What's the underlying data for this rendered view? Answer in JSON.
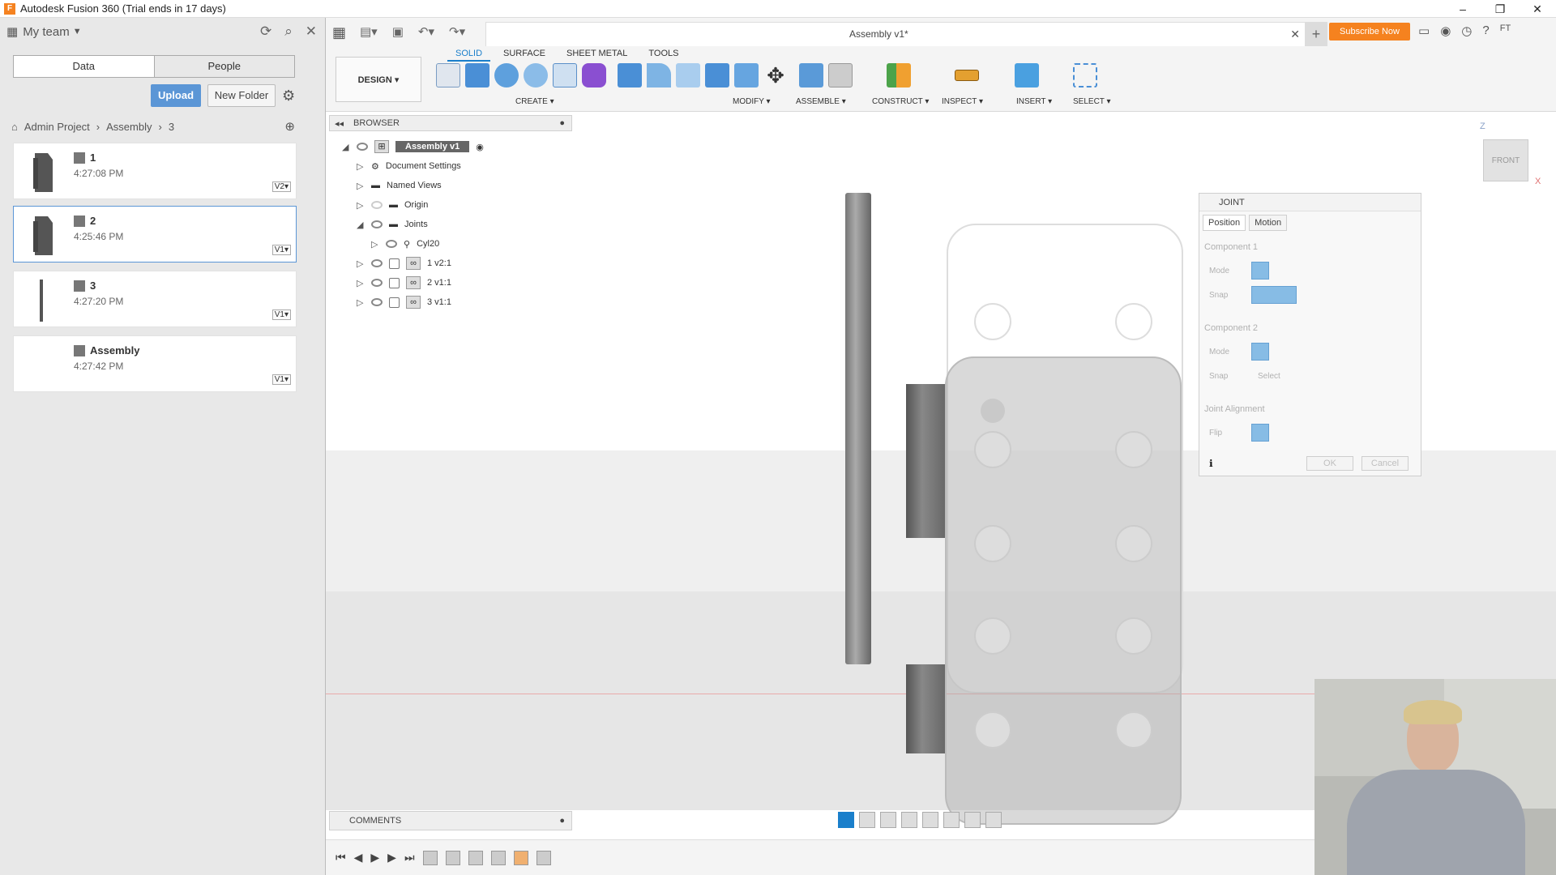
{
  "app": {
    "title": "Autodesk Fusion 360 (Trial ends in 17 days)",
    "logo_letter": "F",
    "icon": "fusion-logo-icon"
  },
  "window_controls": {
    "minimize": "–",
    "maximize": "❐",
    "close": "✕"
  },
  "data_panel": {
    "team_label": "My team",
    "tabs": [
      "Data",
      "People"
    ],
    "active_tab": "Data",
    "upload_label": "Upload",
    "new_folder_label": "New Folder",
    "breadcrumb": [
      "Admin Project",
      "Assembly",
      "3"
    ],
    "files": [
      {
        "name": "1",
        "time": "4:27:08 PM",
        "version": "V2▾"
      },
      {
        "name": "2",
        "time": "4:25:46 PM",
        "version": "V1▾",
        "selected": true
      },
      {
        "name": "3",
        "time": "4:27:20 PM",
        "version": "V1▾"
      },
      {
        "name": "Assembly",
        "time": "4:27:42 PM",
        "version": "V1▾"
      }
    ]
  },
  "document": {
    "tab_title": "Assembly v1*",
    "subscribe_label": "Subscribe Now",
    "user_initials": "FT"
  },
  "ribbon": {
    "tabs": [
      "SOLID",
      "SURFACE",
      "SHEET METAL",
      "TOOLS"
    ],
    "active_tab": "SOLID",
    "workspace_label": "DESIGN ▾",
    "groups": [
      "CREATE ▾",
      "MODIFY ▾",
      "ASSEMBLE ▾",
      "CONSTRUCT ▾",
      "INSPECT ▾",
      "INSERT ▾",
      "SELECT ▾"
    ]
  },
  "browser": {
    "title": "BROWSER",
    "root": "Assembly v1",
    "items": [
      {
        "label": "Document Settings",
        "icon": "gear-icon"
      },
      {
        "label": "Named Views",
        "icon": "folder-icon"
      },
      {
        "label": "Origin",
        "icon": "folder-icon"
      },
      {
        "label": "Joints",
        "icon": "folder-icon",
        "expanded": true
      },
      {
        "label": "Cyl20",
        "icon": "joint-icon",
        "child": true
      },
      {
        "label": "1 v2:1",
        "icon": "link-icon"
      },
      {
        "label": "2 v1:1",
        "icon": "link-icon"
      },
      {
        "label": "3 v1:1",
        "icon": "link-icon"
      }
    ]
  },
  "joint_panel": {
    "title": "JOINT",
    "tabs": [
      "Position",
      "Motion"
    ],
    "component1": "Component 1",
    "component2": "Component 2",
    "alignment": "Joint Alignment",
    "mode_label": "Mode",
    "snap_label": "Snap",
    "snap_select": "Select",
    "flip_label": "Flip",
    "ok_label": "OK",
    "cancel_label": "Cancel"
  },
  "viewcube": {
    "face": "FRONT",
    "axis_z": "Z",
    "axis_x": "X"
  },
  "comments": {
    "title": "COMMENTS"
  },
  "colors": {
    "accent": "#1a7fcb",
    "subscribe": "#f5821f",
    "upload": "#5b96d6"
  }
}
